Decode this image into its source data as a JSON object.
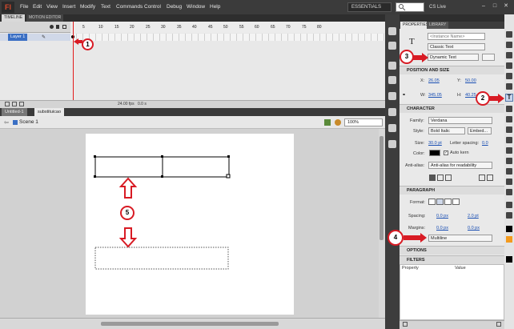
{
  "app": {
    "logo": "Fl"
  },
  "menu": [
    "File",
    "Edit",
    "View",
    "Insert",
    "Modify",
    "Text",
    "Commands",
    "Control",
    "Debug",
    "Window",
    "Help"
  ],
  "header": {
    "workspace": "ESSENTIALS",
    "cs_live": "CS Live"
  },
  "timeline": {
    "tabs": [
      "TIMELINE",
      "MOTION EDITOR"
    ],
    "layer_name": "Layer 1",
    "frame_numbers": [
      "5",
      "10",
      "15",
      "20",
      "25",
      "30",
      "35",
      "40",
      "45",
      "50",
      "55",
      "60",
      "65",
      "70",
      "75",
      "80"
    ],
    "fps": "24.00 fps",
    "time": "0.0 s"
  },
  "documents": {
    "tabs": [
      "Untitled-1",
      "substituicao"
    ],
    "scene": "Scene 1",
    "zoom": "100%"
  },
  "properties": {
    "tabs": [
      "PROPERTIES",
      "LIBRARY"
    ],
    "instance_name_placeholder": "<Instance Name>",
    "text_engine": "Classic Text",
    "text_type": "Dynamic Text",
    "position_size": {
      "title": "POSITION AND SIZE",
      "x_label": "X:",
      "x": "26.05",
      "y_label": "Y:",
      "y": "50.00",
      "w_label": "W:",
      "w": "345.05",
      "h_label": "H:",
      "h": "40.25"
    },
    "character": {
      "title": "CHARACTER",
      "family_label": "Family:",
      "family": "Verdana",
      "style_label": "Style:",
      "style": "Bold Italic",
      "embed": "Embed...",
      "size_label": "Size:",
      "size": "30.0 pt",
      "spacing_label": "Letter spacing:",
      "spacing": "0.0",
      "color_label": "Color:",
      "auto_kern": "Auto kern",
      "antialias_label": "Anti-alias:",
      "antialias": "Anti-alias for readability"
    },
    "paragraph": {
      "title": "PARAGRAPH",
      "format_label": "Format:",
      "spacing_label": "Spacing:",
      "spacing_a": "0.0 px",
      "spacing_b": "2.0 pt",
      "margins_label": "Margins:",
      "margin_a": "0.0 px",
      "margin_b": "0.0 px",
      "behavior": "Multiline"
    },
    "options_title": "OPTIONS",
    "filters": {
      "title": "FILTERS",
      "col_property": "Property",
      "col_value": "Value"
    }
  },
  "annotations": [
    "1",
    "2",
    "3",
    "4",
    "5"
  ],
  "colors": {
    "annotation": "#d81b24",
    "playhead": "#e21b1b",
    "accent": "#d64a2c",
    "text_color_swatch": "#000000"
  },
  "icons": [
    "search-icon",
    "minimize-icon",
    "maximize-icon",
    "close-icon",
    "eye-icon",
    "lock-icon",
    "pencil-icon",
    "selection-tool-icon",
    "text-tool-icon",
    "pen-tool-icon",
    "brush-tool-icon",
    "paint-bucket-icon",
    "eyedropper-icon",
    "eraser-icon",
    "hand-tool-icon",
    "zoom-tool-icon"
  ]
}
